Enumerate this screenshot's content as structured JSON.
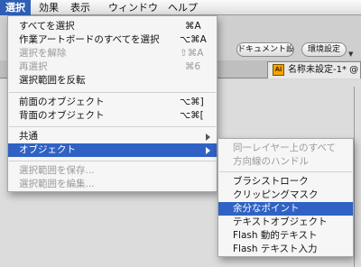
{
  "menubar": {
    "items": [
      {
        "label": "選択",
        "active": true
      },
      {
        "label": "効果"
      },
      {
        "label": "表示"
      },
      {
        "label": "ウィンドウ"
      },
      {
        "label": "ヘルプ"
      }
    ]
  },
  "toolbar": {
    "doc_settings_label": "ドキュメント設定",
    "prefs_label": "環境設定"
  },
  "document_tab": {
    "title": "名称未設定-1* @",
    "icon_text": "Ai"
  },
  "select_menu": {
    "items": [
      {
        "label": "すべてを選択",
        "shortcut": "⌘A"
      },
      {
        "label": "作業アートボードのすべてを選択",
        "shortcut": "⌥⌘A"
      },
      {
        "label": "選択を解除",
        "shortcut": "⇧⌘A",
        "disabled": true
      },
      {
        "label": "再選択",
        "shortcut": "⌘6",
        "disabled": true
      },
      {
        "label": "選択範囲を反転"
      },
      {
        "label": "前面のオブジェクト",
        "shortcut": "⌥⌘]"
      },
      {
        "label": "背面のオブジェクト",
        "shortcut": "⌥⌘["
      },
      {
        "label": "共通"
      },
      {
        "label": "オブジェクト",
        "highlighted": true
      },
      {
        "label": "選択範囲を保存...",
        "disabled": true
      },
      {
        "label": "選択範囲を編集...",
        "disabled": true
      }
    ]
  },
  "object_submenu": {
    "items": [
      {
        "label": "同一レイヤー上のすべて",
        "disabled": true
      },
      {
        "label": "方向線のハンドル",
        "disabled": true
      },
      {
        "label": "ブラシストローク"
      },
      {
        "label": "クリッピングマスク"
      },
      {
        "label": "余分なポイント",
        "highlighted": true
      },
      {
        "label": "テキストオブジェクト"
      },
      {
        "label": "Flash 動的テキスト"
      },
      {
        "label": "Flash テキスト入力"
      }
    ]
  },
  "colors": {
    "highlight": "#2f62c4",
    "disabled_text": "#9a9a9a"
  }
}
